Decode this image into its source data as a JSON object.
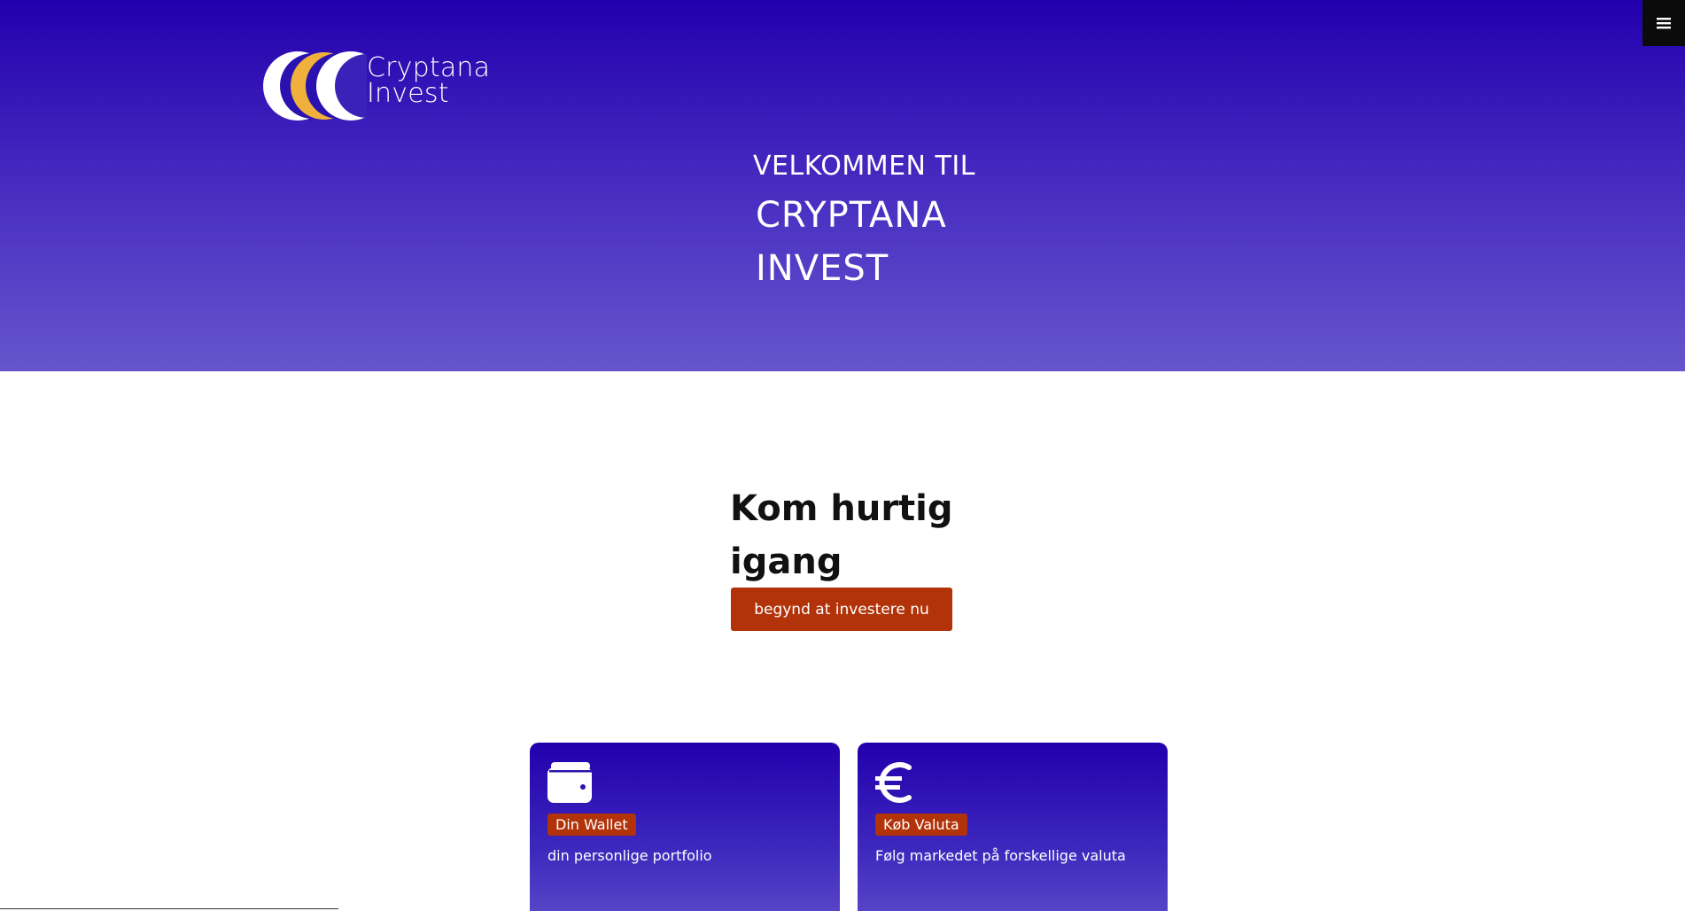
{
  "colors": {
    "hero_top": "#2200ad",
    "hero_bottom": "#6655cc",
    "accent": "#b23309",
    "logo_gold": "#f0b13c",
    "menu_bg": "#0b0b0b"
  },
  "header": {
    "menu_icon": "hamburger-menu-icon",
    "logo": {
      "line1": "Cryptana",
      "line2": "Invest"
    }
  },
  "hero": {
    "welcome": "VELKOMMEN TIL",
    "brand_line1": "CRYPTANA",
    "brand_line2": "INVEST"
  },
  "quickstart": {
    "title": "Kom hurtig igang",
    "button_label": "begynd at investere nu"
  },
  "cards": [
    {
      "icon": "wallet-icon",
      "badge": "Din Wallet",
      "description": "din personlige portfolio"
    },
    {
      "icon": "euro-icon",
      "badge": "Køb Valuta",
      "description": "Følg markedet på forskellige valuta"
    }
  ]
}
